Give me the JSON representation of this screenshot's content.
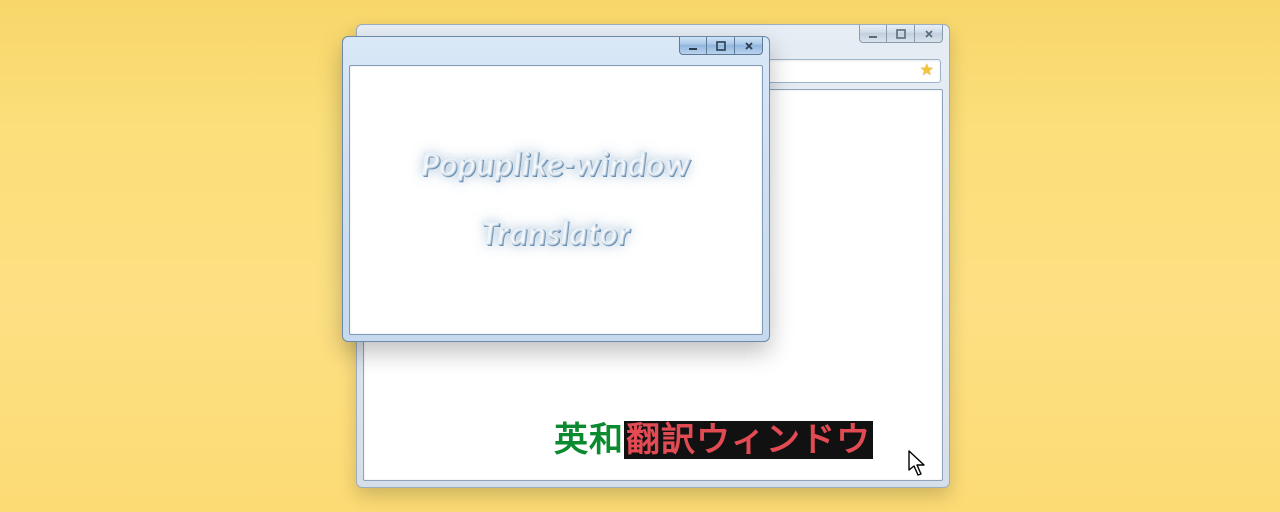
{
  "popup": {
    "line1": "Popuplike-window",
    "line2": "Translator",
    "controls": {
      "minimize_name": "minimize-button",
      "maximize_name": "maximize-button",
      "close_name": "close-button"
    }
  },
  "browser": {
    "controls": {
      "minimize_name": "minimize-button",
      "maximize_name": "maximize-button",
      "close_name": "close-button"
    },
    "jp": {
      "unselected": "英和",
      "selected": "翻訳ウィンドウ"
    }
  },
  "icons": {
    "star": "★"
  }
}
